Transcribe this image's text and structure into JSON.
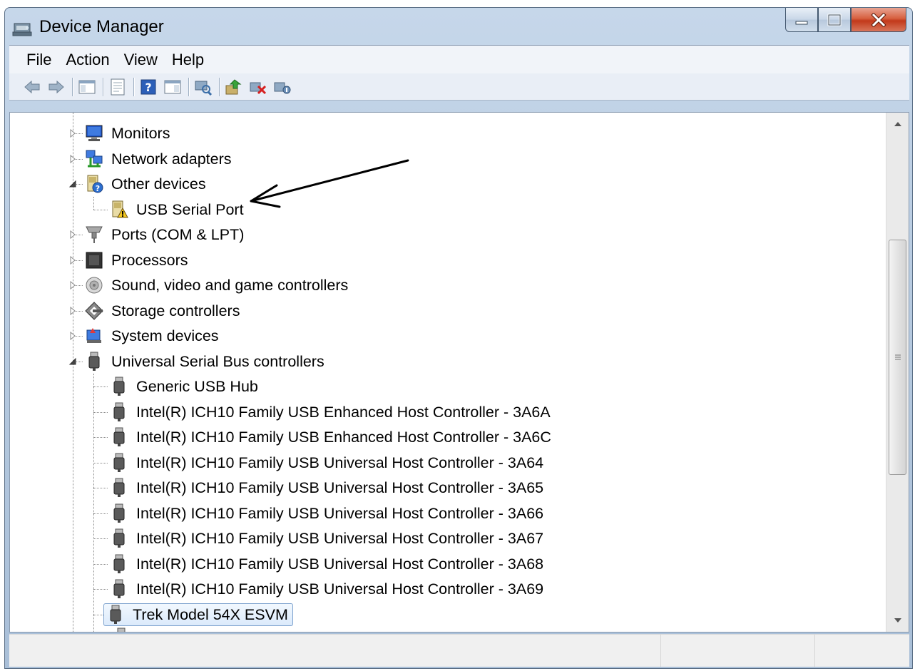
{
  "window": {
    "title": "Device Manager"
  },
  "menu": [
    "File",
    "Action",
    "View",
    "Help"
  ],
  "toolbar": {
    "icons": [
      "back-arrow-icon",
      "forward-arrow-icon",
      "show-hide-console-tree-icon",
      "properties-icon",
      "help-icon",
      "action-pane-icon",
      "scan-hardware-icon",
      "update-driver-icon",
      "uninstall-icon",
      "disable-device-icon"
    ]
  },
  "tree": {
    "categories": {
      "monitors": "Monitors",
      "network": "Network adapters",
      "other": "Other devices",
      "ports": "Ports (COM & LPT)",
      "processors": "Processors",
      "sound": "Sound, video and game controllers",
      "storage": "Storage controllers",
      "system": "System devices",
      "usb": "Universal Serial Bus controllers"
    },
    "other_devices": [
      "USB Serial Port"
    ],
    "usb_devices": [
      "Generic USB Hub",
      "Intel(R) ICH10 Family USB Enhanced Host Controller - 3A6A",
      "Intel(R) ICH10 Family USB Enhanced Host Controller - 3A6C",
      "Intel(R) ICH10 Family USB Universal Host Controller - 3A64",
      "Intel(R) ICH10 Family USB Universal Host Controller - 3A65",
      "Intel(R) ICH10 Family USB Universal Host Controller - 3A66",
      "Intel(R) ICH10 Family USB Universal Host Controller - 3A67",
      "Intel(R) ICH10 Family USB Universal Host Controller - 3A68",
      "Intel(R) ICH10 Family USB Universal Host Controller - 3A69",
      "Trek Model 54X ESVM"
    ],
    "selected_item": "Trek Model 54X ESVM"
  },
  "colors": {
    "selection": "#dbeafb",
    "selection_border": "#7da2ce",
    "close_button": "#c2391a",
    "annotation_arrow": "#000000"
  }
}
